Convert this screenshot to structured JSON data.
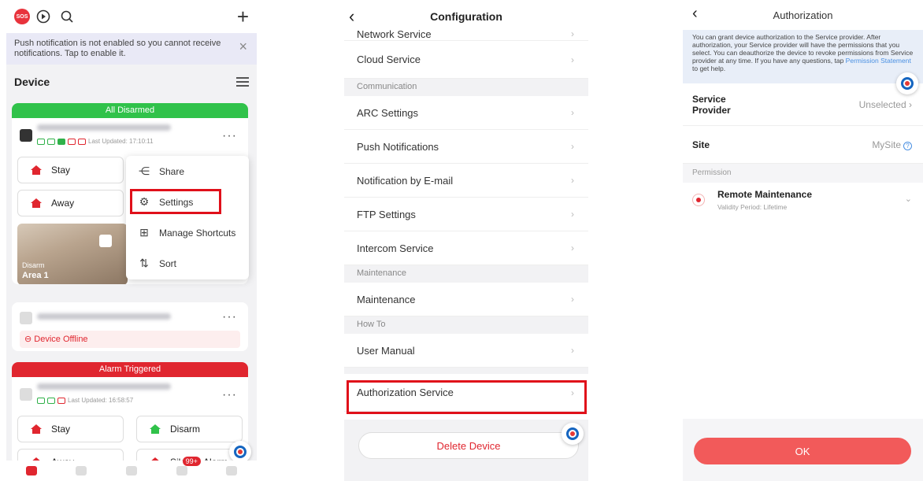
{
  "panel1": {
    "notice": "Push notification is not enabled so you cannot receive notifications. Tap to enable it.",
    "device_heading": "Device",
    "card1": {
      "status_bar": "All Disarmed",
      "last_updated": "Last Updated: 17:10:11",
      "stay_label": "Stay",
      "away_label": "Away",
      "area_state": "Disarm",
      "area_name": "Area 1"
    },
    "menu": {
      "share": "Share",
      "settings": "Settings",
      "manage_shortcuts": "Manage Shortcuts",
      "sort": "Sort"
    },
    "card2": {
      "offline_label": "Device Offline"
    },
    "card3": {
      "status_bar": "Alarm Triggered",
      "last_updated": "Last Updated: 16:58:57",
      "stay_label": "Stay",
      "disarm_label": "Disarm",
      "away_label": "Away",
      "silence_label": "Silence Alarm"
    },
    "tabbar": {
      "badge": "99+"
    },
    "sos_label": "SOS"
  },
  "panel2": {
    "title": "Configuration",
    "rows": {
      "network_service": "Network Service",
      "cloud_service": "Cloud Service",
      "communication_header": "Communication",
      "arc_settings": "ARC Settings",
      "push_notifications": "Push Notifications",
      "notification_email": "Notification by E-mail",
      "ftp_settings": "FTP Settings",
      "intercom_service": "Intercom Service",
      "maintenance_header": "Maintenance",
      "maintenance": "Maintenance",
      "howto_header": "How To",
      "user_manual": "User Manual",
      "authorization_service": "Authorization Service"
    },
    "delete_button": "Delete Device"
  },
  "panel3": {
    "title": "Authorization",
    "info_text": "You can grant device authorization to the Service provider. After authorization, your Service provider will have the permissions that you select. You can deauthorize the device to revoke permissions from Service provider at any time. If you have any questions, tap ",
    "info_link": "Permission Statement",
    "info_tail": " to get help.",
    "service_provider_label": "Service Provider",
    "service_provider_value": "Unselected",
    "site_label": "Site",
    "site_value": "MySite",
    "permission_header": "Permission",
    "permission_title": "Remote Maintenance",
    "permission_sub": "Validity Period:  Lifetime",
    "ok_button": "OK"
  },
  "colors": {
    "accent_red": "#e0262f",
    "green": "#30c24a",
    "highlight": "#e0101a",
    "ok": "#f25a5a"
  }
}
